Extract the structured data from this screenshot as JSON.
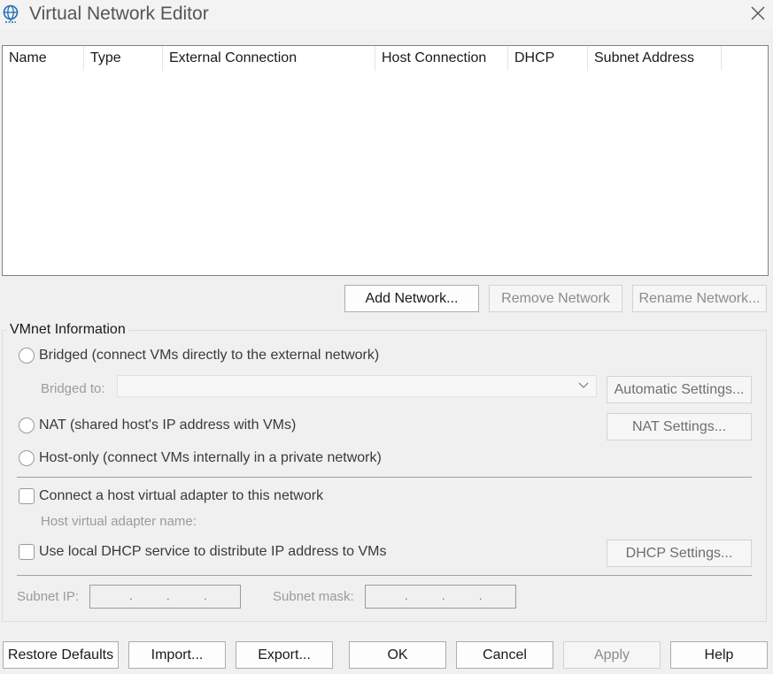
{
  "window": {
    "title": "Virtual Network Editor"
  },
  "table": {
    "columns": [
      "Name",
      "Type",
      "External Connection",
      "Host Connection",
      "DHCP",
      "Subnet Address"
    ]
  },
  "network_buttons": {
    "add": "Add Network...",
    "remove": "Remove Network",
    "rename": "Rename Network..."
  },
  "vmnet": {
    "group_label": "VMnet Information",
    "bridged": "Bridged (connect VMs directly to the external network)",
    "bridged_to_label": "Bridged to:",
    "bridged_to_value": "",
    "automatic_settings": "Automatic Settings...",
    "nat": "NAT (shared host's IP address with VMs)",
    "nat_settings": "NAT Settings...",
    "host_only": "Host-only (connect VMs internally in a private network)",
    "connect_adapter": "Connect a host virtual adapter to this network",
    "adapter_name_label": "Host virtual adapter name:",
    "use_dhcp": "Use local DHCP service to distribute IP address to VMs",
    "dhcp_settings": "DHCP Settings...",
    "subnet_ip_label": "Subnet IP:",
    "subnet_mask_label": "Subnet mask:"
  },
  "footer": {
    "restore": "Restore Defaults",
    "import": "Import...",
    "export": "Export...",
    "ok": "OK",
    "cancel": "Cancel",
    "apply": "Apply",
    "help": "Help"
  }
}
